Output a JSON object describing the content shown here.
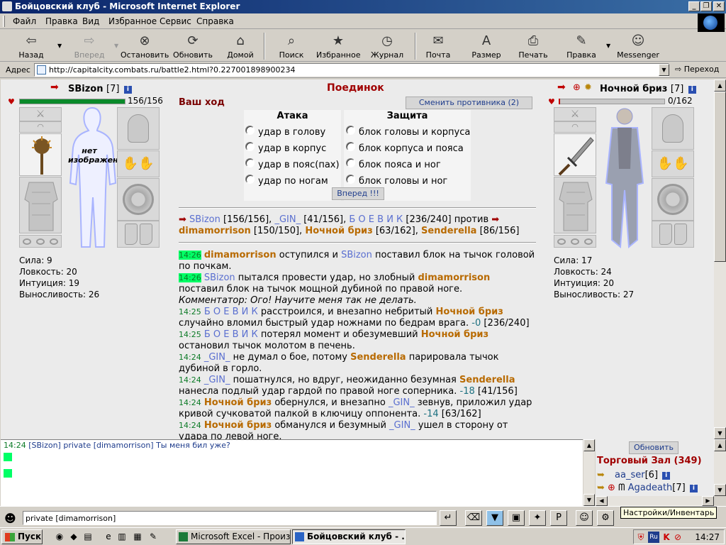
{
  "window": {
    "title": "Бойцовский клуб - Microsoft Internet Explorer"
  },
  "menu": [
    "Файл",
    "Правка",
    "Вид",
    "Избранное",
    "Сервис",
    "Справка"
  ],
  "toolbar": {
    "back": "Назад",
    "forward": "Вперед",
    "stop": "Остановить",
    "refresh": "Обновить",
    "home": "Домой",
    "search": "Поиск",
    "favorites": "Избранное",
    "history": "Журнал",
    "mail": "Почта",
    "size": "Размер",
    "print": "Печать",
    "edit": "Правка",
    "messenger": "Messenger"
  },
  "address": {
    "label": "Адрес",
    "url": "http://capitalcity.combats.ru/battle2.html?0.227001898900234",
    "go": "Переход"
  },
  "battle": {
    "title": "Поединок",
    "your_turn": "Ваш ход",
    "change_opponent": "Сменить противника (2)",
    "attack_header": "Атака",
    "defense_header": "Защита",
    "attacks": [
      "удар в голову",
      "удар в корпус",
      "удар в пояс(пах)",
      "удар по ногам"
    ],
    "defenses": [
      "блок головы и корпуса",
      "блок корпуса и пояса",
      "блок пояса и ног",
      "блок головы и ног"
    ],
    "go_button": "Вперед !!!"
  },
  "player": {
    "name": "SBizon",
    "level": "[7]",
    "hp_text": "156/156",
    "hp_fraction": 1.0,
    "no_image": "нет изображения",
    "stats": [
      "Сила: 9",
      "Ловкость: 20",
      "Интуиция: 19",
      "Выносливость: 26"
    ]
  },
  "opponent": {
    "name": "Ночной бриз",
    "level": "[7]",
    "hp_text": "0/162",
    "hp_fraction": 0.0,
    "stats": [
      "Сила: 17",
      "Ловкость: 24",
      "Интуиция: 20",
      "Выносливость: 27"
    ]
  },
  "teams": {
    "t1": [
      "SBizon",
      "[156/156],",
      "_GIN_",
      "[41/156],",
      "Б О Е В И К",
      "[236/240]"
    ],
    "vs": "против",
    "t2": [
      "dimamorrison",
      "[150/150],",
      "Ночной бриз",
      "[63/162],",
      "Senderella",
      "[86/156]"
    ]
  },
  "log": [
    {
      "time": "14:26",
      "hl": true,
      "parts": [
        [
          "o",
          "dimamorrison"
        ],
        [
          "t",
          " оступился и "
        ],
        [
          "b",
          "SBizon"
        ],
        [
          "t",
          " поставил блок на тычок головой по почкам."
        ]
      ]
    },
    {
      "time": "14:26",
      "hl": true,
      "parts": [
        [
          "b",
          "SBizon"
        ],
        [
          "t",
          " пытался провести удар, но злобный "
        ],
        [
          "o",
          "dimamorrison"
        ],
        [
          "t",
          " поставил блок на тычок мощной дубиной по правой ноге."
        ]
      ]
    },
    {
      "time": "",
      "hl": false,
      "parts": [
        [
          "c",
          "Комментатор: Ого! Научите меня так не делать."
        ]
      ]
    },
    {
      "time": "14:25",
      "hl": false,
      "parts": [
        [
          "b",
          "Б О Е В И К"
        ],
        [
          "t",
          " расстроился, и внезапно небритый "
        ],
        [
          "o",
          "Ночной бриз"
        ],
        [
          "t",
          " случайно вломил быстрый удар ножнами по бедрам врага. "
        ],
        [
          "n",
          "-0"
        ],
        [
          "t",
          " [236/240]"
        ]
      ]
    },
    {
      "time": "14:25",
      "hl": false,
      "parts": [
        [
          "b",
          "Б О Е В И К"
        ],
        [
          "t",
          " потерял момент и обезумевший "
        ],
        [
          "o",
          "Ночной бриз"
        ],
        [
          "t",
          " остановил тычок молотом в печень."
        ]
      ]
    },
    {
      "time": "14:24",
      "hl": false,
      "parts": [
        [
          "b",
          "_GIN_"
        ],
        [
          "t",
          " не думал о бое, потому "
        ],
        [
          "o",
          "Senderella"
        ],
        [
          "t",
          " парировала тычок дубиной в горло."
        ]
      ]
    },
    {
      "time": "14:24",
      "hl": false,
      "parts": [
        [
          "b",
          "_GIN_"
        ],
        [
          "t",
          " пошатнулся, но вдруг, неожиданно безумная "
        ],
        [
          "o",
          "Senderella"
        ],
        [
          "t",
          " нанесла подлый удар гардой по правой ноге соперника. "
        ],
        [
          "n",
          "-18"
        ],
        [
          "t",
          " [41/156]"
        ]
      ]
    },
    {
      "time": "14:24",
      "hl": false,
      "parts": [
        [
          "o",
          "Ночной бриз"
        ],
        [
          "t",
          " обернулся, и внезапно "
        ],
        [
          "b",
          "_GIN_"
        ],
        [
          "t",
          " зевнув, приложил удар кривой сучковатой палкой в ключицу оппонента. "
        ],
        [
          "n",
          "-14"
        ],
        [
          "t",
          " [63/162]"
        ]
      ]
    },
    {
      "time": "14:24",
      "hl": false,
      "parts": [
        [
          "o",
          "Ночной бриз"
        ],
        [
          "t",
          " обманулся и безумный "
        ],
        [
          "b",
          "_GIN_"
        ],
        [
          "t",
          " ушел в сторону от удара по левой ноге."
        ]
      ]
    }
  ],
  "chat": {
    "first_time": "14:24",
    "first_text": "[SBizon] private [dimamorrison] Ты меня бил уже?",
    "input_value": "private [dimamorrison]"
  },
  "room": {
    "refresh": "Обновить",
    "title": "Торговый Зал (349)",
    "users": [
      {
        "name": "aa_ser",
        "level": "[6]"
      },
      {
        "name": "Agadeath",
        "level": "[7]"
      }
    ]
  },
  "tooltip": "Настройки/Инвентарь",
  "taskbar": {
    "start": "Пуск",
    "tasks": [
      "Microsoft Excel - Произво...",
      "Бойцовский клуб - ..."
    ],
    "clock": "14:27"
  }
}
